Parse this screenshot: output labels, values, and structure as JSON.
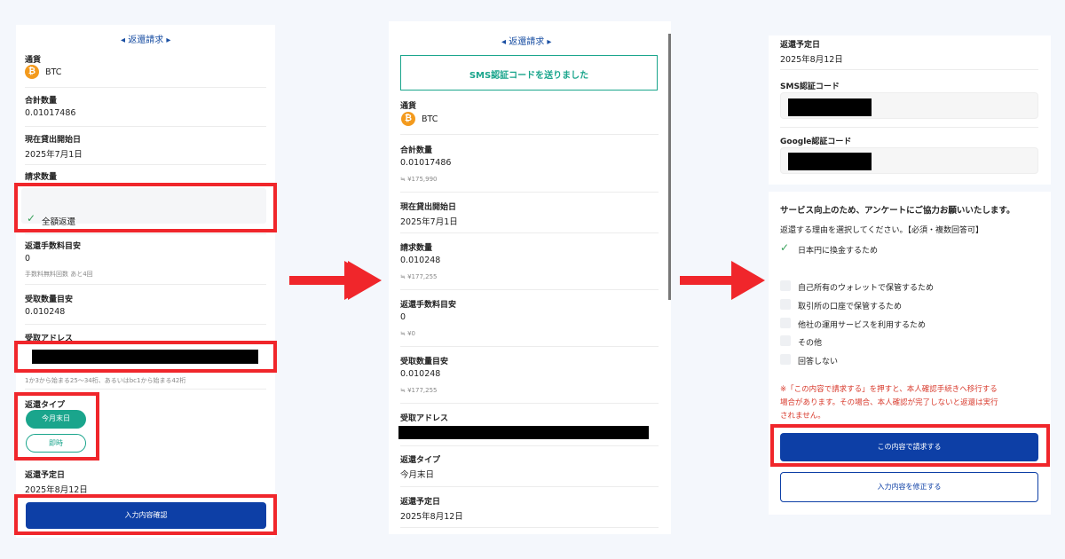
{
  "panel1": {
    "title": "◂ 返還請求 ▸",
    "currency_label": "通貨",
    "currency_value": "BTC",
    "total_label": "合計数量",
    "total_value": "0.01017486",
    "start_label": "現在貸出開始日",
    "start_value": "2025年7月1日",
    "request_label": "請求数量",
    "full_return": "全額返還",
    "fee_label": "返還手数料目安",
    "fee_value": "0",
    "fee_note": "手数料無料回数 あと4回",
    "receive_amount_label": "受取数量目安",
    "receive_amount_value": "0.010248",
    "address_label": "受取アドレス",
    "address_note": "1か3から始まる25〜34桁、あるいはbc1から始まる42桁",
    "type_label": "返還タイプ",
    "type_option_1": "今月末日",
    "type_option_2": "即時",
    "date_label": "返還予定日",
    "date_value": "2025年8月12日",
    "confirm_button": "入力内容確認"
  },
  "panel2": {
    "title": "◂ 返還請求 ▸",
    "sms_notice": "SMS認証コードを送りました",
    "currency_label": "通貨",
    "currency_value": "BTC",
    "total_label": "合計数量",
    "total_value": "0.01017486",
    "total_jpy": "≒ ¥175,990",
    "start_label": "現在貸出開始日",
    "start_value": "2025年7月1日",
    "request_label": "請求数量",
    "request_value": "0.010248",
    "request_jpy": "≒ ¥177,255",
    "fee_label": "返還手数料目安",
    "fee_value": "0",
    "fee_jpy": "≒ ¥0",
    "receive_amount_label": "受取数量目安",
    "receive_amount_value": "0.010248",
    "receive_amount_jpy": "≒ ¥177,255",
    "address_label": "受取アドレス",
    "type_label": "返還タイプ",
    "type_value": "今月末日",
    "date_label": "返還予定日",
    "date_value": "2025年8月12日"
  },
  "panel3": {
    "date_label": "返還予定日",
    "date_value": "2025年8月12日",
    "sms_label": "SMS認証コード",
    "google_label": "Google認証コード",
    "survey_title": "サービス向上のため、アンケートにご協力お願いいたします。",
    "survey_instruction": "返還する理由を選択してください。【必須・複数回答可】",
    "options": [
      {
        "label": "日本円に換金するため",
        "checked": true
      },
      {
        "label": "自己所有のウォレットで保管するため",
        "checked": false
      },
      {
        "label": "取引所の口座で保管するため",
        "checked": false
      },
      {
        "label": "他社の運用サービスを利用するため",
        "checked": false
      },
      {
        "label": "その他",
        "checked": false
      },
      {
        "label": "回答しない",
        "checked": false
      }
    ],
    "warning_line1": "※「この内容で請求する」を押すと、本人確認手続きへ移行する",
    "warning_line2": "場合があります。その場合、本人確認が完了しないと返還は実行",
    "warning_line3": "されません。",
    "submit_button": "この内容で請求する",
    "edit_button": "入力内容を修正する"
  },
  "colors": {
    "accent_blue": "#0d3fa6",
    "teal": "#1aa58c",
    "highlight_red": "#f0262b",
    "btc_orange": "#f39a1d"
  }
}
